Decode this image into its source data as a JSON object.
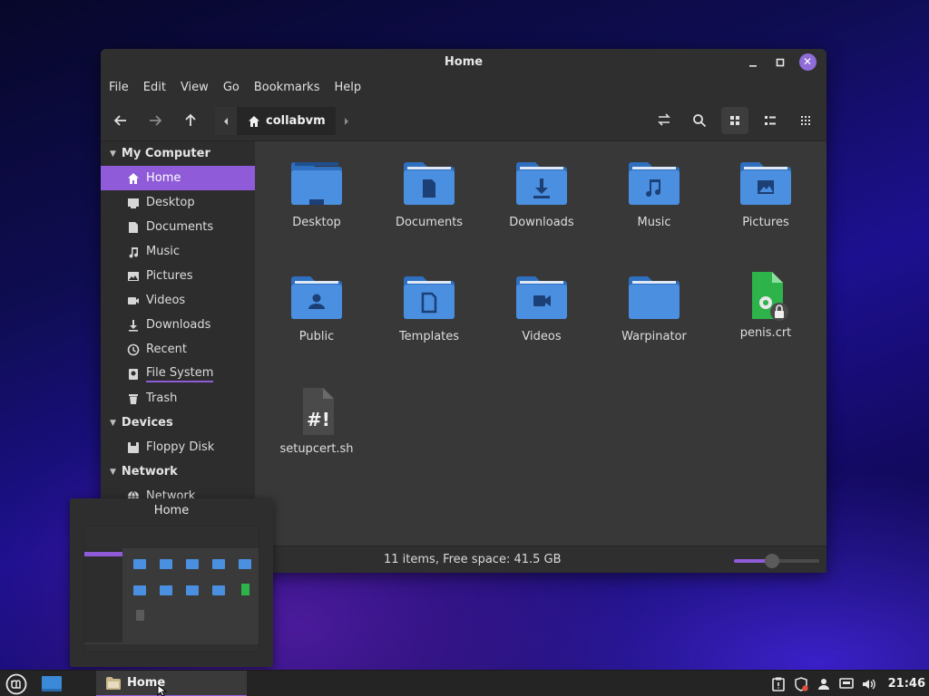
{
  "window": {
    "title": "Home"
  },
  "menu": [
    "File",
    "Edit",
    "View",
    "Go",
    "Bookmarks",
    "Help"
  ],
  "location": {
    "current": "collabvm"
  },
  "sidebar": {
    "sections": [
      {
        "title": "My Computer",
        "items": [
          {
            "label": "Home",
            "icon": "home-icon",
            "active": true
          },
          {
            "label": "Desktop",
            "icon": "desktop-icon"
          },
          {
            "label": "Documents",
            "icon": "document-icon"
          },
          {
            "label": "Music",
            "icon": "music-icon"
          },
          {
            "label": "Pictures",
            "icon": "picture-icon"
          },
          {
            "label": "Videos",
            "icon": "video-icon"
          },
          {
            "label": "Downloads",
            "icon": "download-icon"
          },
          {
            "label": "Recent",
            "icon": "recent-icon"
          },
          {
            "label": "File System",
            "icon": "drive-icon"
          },
          {
            "label": "Trash",
            "icon": "trash-icon"
          }
        ]
      },
      {
        "title": "Devices",
        "items": [
          {
            "label": "Floppy Disk",
            "icon": "floppy-icon"
          }
        ]
      },
      {
        "title": "Network",
        "items": [
          {
            "label": "Network",
            "icon": "network-icon"
          }
        ]
      }
    ]
  },
  "files": [
    {
      "name": "Desktop",
      "type": "folder",
      "emblem": "desktop"
    },
    {
      "name": "Documents",
      "type": "folder",
      "emblem": "document"
    },
    {
      "name": "Downloads",
      "type": "folder",
      "emblem": "download"
    },
    {
      "name": "Music",
      "type": "folder",
      "emblem": "music"
    },
    {
      "name": "Pictures",
      "type": "folder",
      "emblem": "picture"
    },
    {
      "name": "Public",
      "type": "folder",
      "emblem": "person"
    },
    {
      "name": "Templates",
      "type": "folder",
      "emblem": "template"
    },
    {
      "name": "Videos",
      "type": "folder",
      "emblem": "video"
    },
    {
      "name": "Warpinator",
      "type": "folder",
      "emblem": ""
    },
    {
      "name": "penis.crt",
      "type": "certificate"
    },
    {
      "name": "setupcert.sh",
      "type": "script"
    }
  ],
  "status": {
    "text": "11 items, Free space: 41.5 GB",
    "zoom_fraction": 0.45
  },
  "preview": {
    "title": "Home"
  },
  "taskbar": {
    "window_label": "Home",
    "clock": "21:46"
  },
  "colors": {
    "accent": "#8f5bd9",
    "folder": "#4a8fe0",
    "folder_tab": "#3a79cc"
  }
}
